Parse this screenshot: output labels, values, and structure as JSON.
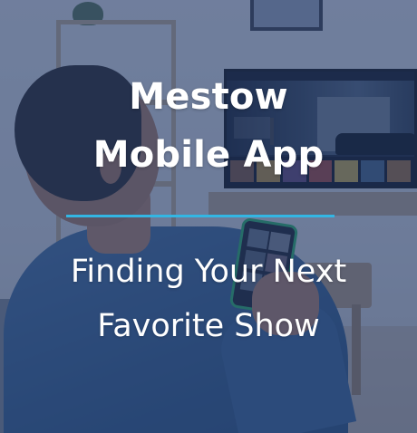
{
  "title": {
    "line1": "Mestow",
    "line2": "Mobile App"
  },
  "subtitle": {
    "line1": "Finding Your Next",
    "line2": "Favorite Show"
  },
  "colors": {
    "overlay": "#22386a",
    "divider": "#33b6e3",
    "text": "#ffffff",
    "phone_case": "#2fbf6a"
  },
  "background_photo": "man-watching-tv-with-phone"
}
